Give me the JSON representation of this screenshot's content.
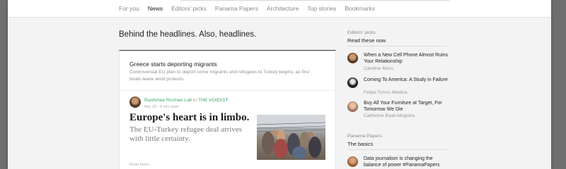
{
  "nav": {
    "items": [
      "For you",
      "News",
      "Editors' picks",
      "Panama Papers",
      "Architecture",
      "Top stories",
      "Bookmarks"
    ],
    "active": "News"
  },
  "main": {
    "headline": "Behind the headlines. Also, headlines.",
    "story": {
      "title": "Greece starts deporting migrants",
      "description": "Controversial EU plan to deport some migrants and refugees to Turkey begins, as first boats leave amid protests."
    },
    "article": {
      "author": "Rashmee Roshan Lall",
      "in_text": "in",
      "publication": "THE VOIDIST",
      "meta": "Mar 23 · 4 min read",
      "title": "Europe's heart is in limbo.",
      "subtitle": "The EU-Turkey refugee deal arrives with little certainty.",
      "read_more": "Read more…"
    }
  },
  "sidebar": {
    "editors_picks": {
      "label": "Editors' picks",
      "title": "Read these now",
      "items": [
        {
          "title": "When a New Cell Phone Almost Ruins Your Relationship",
          "author": "Caroline Moss"
        },
        {
          "title": "Coming To America: A Study in Failure",
          "author": "Felipe Torres Medina"
        },
        {
          "title": "Buy All Your Furniture at Target, For Tomorrow We Die",
          "author": "Catherine Baab-Muguira"
        }
      ]
    },
    "panama_papers": {
      "label": "Panama Papers",
      "title": "The basics",
      "items": [
        {
          "title": "Data journalism is changing the balance of power #PanamaPapers"
        }
      ]
    }
  },
  "colors": {
    "accent_green": "#3aa86a",
    "page_bg": "#f3f3f3",
    "text_dark": "#222222"
  }
}
